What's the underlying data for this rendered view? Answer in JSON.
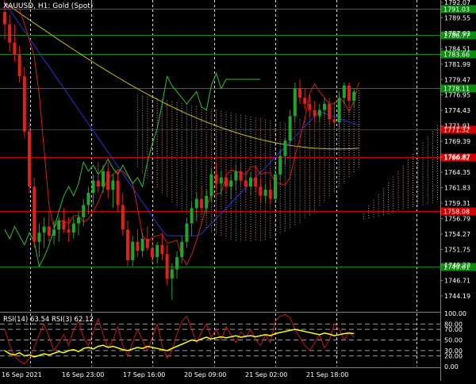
{
  "window": {
    "title": "XAUUSD, H1:  Gold (Spot)"
  },
  "colors": {
    "background": "#000000",
    "bull": "#1fa52a",
    "bear": "#e0201c",
    "grid": "#ffffff",
    "ma_red": "#d0201a",
    "ma_blue": "#2a34e0",
    "ma_yellow": "#c8c010",
    "chikou": "#2cc230",
    "cloud": "#e0b090",
    "level_green": "#0c8a10",
    "level_red": "#d00000",
    "rsi_fast": "#c81818",
    "rsi_slow": "#ffff00"
  },
  "chart_data": [
    {
      "type": "candlestick",
      "title": "XAUUSD, H1:  Gold (Spot)",
      "ylim": [
        1741.71,
        1792.45
      ],
      "y_ticks": [
        "1792.07",
        "1789.55",
        "1787.03",
        "1784.51",
        "1781.99",
        "1779.47",
        "1776.95",
        "1774.43",
        "1771.91",
        "1769.39",
        "1766.87",
        "1764.35",
        "1761.83",
        "1759.31",
        "1756.79",
        "1754.27",
        "1751.75",
        "1749.23",
        "1746.71",
        "1744.19"
      ],
      "x_ticks": [
        "16 Sep 2021",
        "16 Sep 23:00",
        "17 Sep 16:00",
        "20 Sep 09:00",
        "21 Sep 02:00",
        "21 Sep 18:00"
      ],
      "levels": [
        {
          "value": 1791.03,
          "label": "1791.03",
          "color": "green"
        },
        {
          "value": 1786.77,
          "label": "1786.77",
          "color": "green"
        },
        {
          "value": 1783.66,
          "label": "1783.66",
          "color": "green"
        },
        {
          "value": 1778.11,
          "label": "1778.11",
          "color": "green"
        },
        {
          "value": 1771.32,
          "label": "1771.32",
          "color": "red"
        },
        {
          "value": 1766.82,
          "label": "1766.82",
          "color": "red"
        },
        {
          "value": 1758.08,
          "label": "1758.08",
          "color": "red"
        },
        {
          "value": 1749.01,
          "label": "1749.01",
          "color": "green"
        }
      ],
      "candles": [
        [
          1790.5,
          1793.0,
          1786.0,
          1788.5
        ],
        [
          1788.5,
          1790.0,
          1784.0,
          1785.5
        ],
        [
          1785.5,
          1788.5,
          1782.5,
          1783.5
        ],
        [
          1783.5,
          1785.0,
          1779.0,
          1780.0
        ],
        [
          1780.0,
          1781.5,
          1770.0,
          1771.0
        ],
        [
          1771.0,
          1772.5,
          1761.0,
          1762.0
        ],
        [
          1762.0,
          1763.5,
          1752.0,
          1753.0
        ],
        [
          1753.0,
          1756.0,
          1750.5,
          1754.5
        ],
        [
          1754.5,
          1757.0,
          1752.0,
          1755.5
        ],
        [
          1755.5,
          1758.0,
          1753.0,
          1754.0
        ],
        [
          1754.0,
          1756.5,
          1752.5,
          1755.0
        ],
        [
          1755.0,
          1757.0,
          1753.0,
          1756.5
        ],
        [
          1756.5,
          1758.5,
          1754.5,
          1755.0
        ],
        [
          1755.0,
          1757.0,
          1753.0,
          1754.5
        ],
        [
          1754.5,
          1757.0,
          1753.5,
          1756.0
        ],
        [
          1756.0,
          1758.0,
          1754.0,
          1757.0
        ],
        [
          1757.0,
          1760.0,
          1755.5,
          1759.0
        ],
        [
          1759.0,
          1762.0,
          1757.5,
          1761.0
        ],
        [
          1761.0,
          1764.0,
          1759.0,
          1763.0
        ],
        [
          1763.0,
          1766.0,
          1761.0,
          1762.0
        ],
        [
          1762.0,
          1765.5,
          1761.0,
          1764.5
        ],
        [
          1764.5,
          1766.0,
          1760.0,
          1761.5
        ],
        [
          1761.5,
          1764.0,
          1758.5,
          1763.0
        ],
        [
          1763.0,
          1764.5,
          1758.0,
          1759.0
        ],
        [
          1759.0,
          1761.0,
          1754.0,
          1755.0
        ],
        [
          1755.0,
          1756.5,
          1749.0,
          1750.0
        ],
        [
          1750.0,
          1754.0,
          1749.0,
          1753.0
        ],
        [
          1753.0,
          1755.0,
          1750.5,
          1751.5
        ],
        [
          1751.5,
          1754.5,
          1750.5,
          1753.5
        ],
        [
          1753.5,
          1755.5,
          1751.5,
          1752.0
        ],
        [
          1752.0,
          1753.5,
          1749.5,
          1750.5
        ],
        [
          1750.5,
          1753.0,
          1749.5,
          1752.5
        ],
        [
          1752.5,
          1754.5,
          1750.0,
          1751.0
        ],
        [
          1751.0,
          1752.5,
          1746.0,
          1747.0
        ],
        [
          1747.0,
          1749.5,
          1743.5,
          1748.5
        ],
        [
          1748.5,
          1751.5,
          1747.0,
          1750.5
        ],
        [
          1750.5,
          1754.0,
          1749.5,
          1753.0
        ],
        [
          1753.0,
          1757.0,
          1752.0,
          1756.0
        ],
        [
          1756.0,
          1759.5,
          1754.0,
          1758.5
        ],
        [
          1758.5,
          1761.0,
          1756.5,
          1760.0
        ],
        [
          1760.0,
          1762.0,
          1757.5,
          1758.5
        ],
        [
          1758.5,
          1761.5,
          1757.5,
          1760.5
        ],
        [
          1760.5,
          1765.0,
          1759.5,
          1764.0
        ],
        [
          1764.0,
          1766.0,
          1761.5,
          1762.5
        ],
        [
          1762.5,
          1764.5,
          1760.5,
          1763.5
        ],
        [
          1763.5,
          1765.0,
          1761.0,
          1762.0
        ],
        [
          1762.0,
          1764.0,
          1760.0,
          1763.0
        ],
        [
          1763.0,
          1765.5,
          1761.5,
          1764.5
        ],
        [
          1764.5,
          1766.0,
          1762.0,
          1763.0
        ],
        [
          1763.0,
          1764.5,
          1761.0,
          1762.0
        ],
        [
          1762.0,
          1764.5,
          1760.5,
          1763.5
        ],
        [
          1763.5,
          1765.0,
          1761.0,
          1762.0
        ],
        [
          1762.0,
          1763.5,
          1759.5,
          1760.5
        ],
        [
          1760.5,
          1762.5,
          1759.5,
          1761.5
        ],
        [
          1761.5,
          1763.0,
          1759.0,
          1760.0
        ],
        [
          1760.0,
          1765.0,
          1759.5,
          1764.0
        ],
        [
          1764.0,
          1768.0,
          1763.0,
          1767.0
        ],
        [
          1767.0,
          1770.0,
          1765.5,
          1769.5
        ],
        [
          1769.5,
          1774.5,
          1768.5,
          1773.5
        ],
        [
          1773.5,
          1779.0,
          1772.5,
          1778.0
        ],
        [
          1778.0,
          1779.5,
          1775.5,
          1776.5
        ],
        [
          1776.5,
          1778.0,
          1774.5,
          1775.5
        ],
        [
          1775.5,
          1777.0,
          1773.5,
          1774.5
        ],
        [
          1774.5,
          1776.0,
          1772.5,
          1773.5
        ],
        [
          1773.5,
          1775.5,
          1772.5,
          1774.5
        ],
        [
          1774.5,
          1776.5,
          1773.5,
          1775.5
        ],
        [
          1775.5,
          1776.5,
          1772.0,
          1773.0
        ],
        [
          1773.0,
          1775.0,
          1771.5,
          1772.5
        ],
        [
          1772.5,
          1777.5,
          1771.5,
          1776.5
        ],
        [
          1776.5,
          1779.0,
          1775.5,
          1778.5
        ],
        [
          1778.5,
          1779.0,
          1775.0,
          1776.0
        ],
        [
          1776.0,
          1778.0,
          1775.0,
          1777.5
        ]
      ]
    },
    {
      "type": "line",
      "title": "RSI(14) 63.54 RSI(3) 62.12",
      "ylim": [
        0,
        100
      ],
      "y_ticks": [
        "100.00",
        "80.00",
        "70.00",
        "50.00",
        "30.00",
        "20.00",
        "0.00"
      ],
      "series": [
        {
          "name": "RSI(14)",
          "value": 63.54
        },
        {
          "name": "RSI(3)",
          "value": 62.12
        }
      ],
      "rsi_slow_values": [
        30,
        24,
        22,
        26,
        20,
        22,
        18,
        21,
        24,
        22,
        25,
        28,
        26,
        30,
        32,
        28,
        34,
        36,
        33,
        38,
        40,
        36,
        38,
        35,
        32,
        30,
        33,
        36,
        34,
        38,
        36,
        34,
        32,
        30,
        34,
        38,
        42,
        46,
        50,
        48,
        52,
        55,
        52,
        54,
        56,
        54,
        56,
        58,
        55,
        57,
        58,
        56,
        58,
        60,
        58,
        62,
        64,
        66,
        68,
        70,
        68,
        66,
        64,
        62,
        60,
        63,
        61,
        58,
        60,
        62,
        63,
        62
      ],
      "rsi_fast_values": [
        70,
        40,
        20,
        10,
        5,
        15,
        35,
        60,
        80,
        55,
        30,
        45,
        60,
        40,
        70,
        85,
        55,
        40,
        65,
        90,
        60,
        35,
        50,
        75,
        40,
        20,
        45,
        70,
        50,
        30,
        55,
        80,
        40,
        15,
        30,
        60,
        85,
        95,
        70,
        45,
        65,
        80,
        55,
        70,
        50,
        75,
        60,
        45,
        65,
        55,
        70,
        50,
        40,
        60,
        45,
        85,
        95,
        98,
        92,
        70,
        55,
        40,
        30,
        45,
        60,
        35,
        50,
        80,
        70,
        50,
        65,
        55
      ]
    }
  ]
}
